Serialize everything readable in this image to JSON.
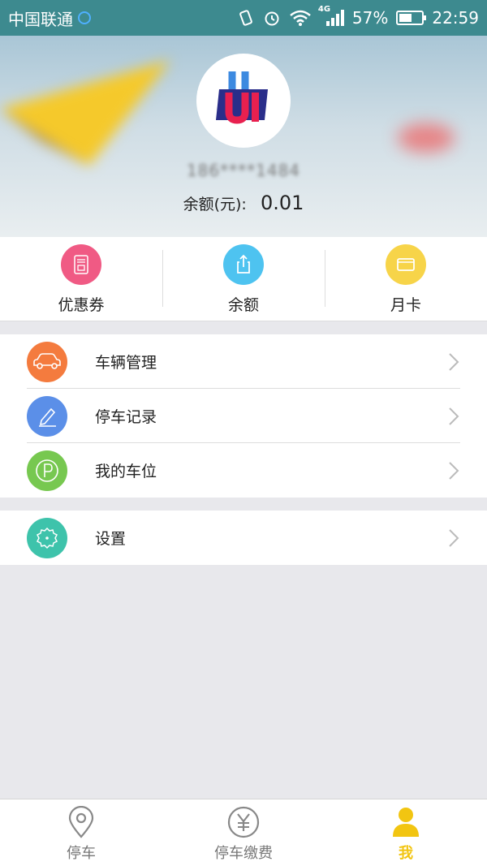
{
  "status_bar": {
    "carrier": "中国联通",
    "network": "4G",
    "battery_percent_text": "57%",
    "battery_level": 0.57,
    "time": "22:59"
  },
  "profile": {
    "phone_masked": "186****1484",
    "balance_label": "余额(元):",
    "balance_value": "0.01",
    "avatar_icon": "ui-logo-icon"
  },
  "quick_actions": [
    {
      "label": "优惠券",
      "icon": "coupon-icon",
      "color": "#f05a84"
    },
    {
      "label": "余额",
      "icon": "share-icon",
      "color": "#4ec3f0"
    },
    {
      "label": "月卡",
      "icon": "card-icon",
      "color": "#f7d449"
    }
  ],
  "menu": {
    "group1": [
      {
        "label": "车辆管理",
        "icon": "car-icon",
        "color": "#f47b3e"
      },
      {
        "label": "停车记录",
        "icon": "pencil-icon",
        "color": "#5b8fe8"
      },
      {
        "label": "我的车位",
        "icon": "parking-icon",
        "color": "#77c850"
      }
    ],
    "group2": [
      {
        "label": "设置",
        "icon": "gear-icon",
        "color": "#3ec3ab"
      }
    ]
  },
  "tabbar": {
    "tabs": [
      {
        "label": "停车",
        "icon": "location-pin-icon"
      },
      {
        "label": "停车缴费",
        "icon": "yen-icon"
      },
      {
        "label": "我",
        "icon": "user-icon"
      }
    ],
    "active_color": "#f2c511"
  }
}
